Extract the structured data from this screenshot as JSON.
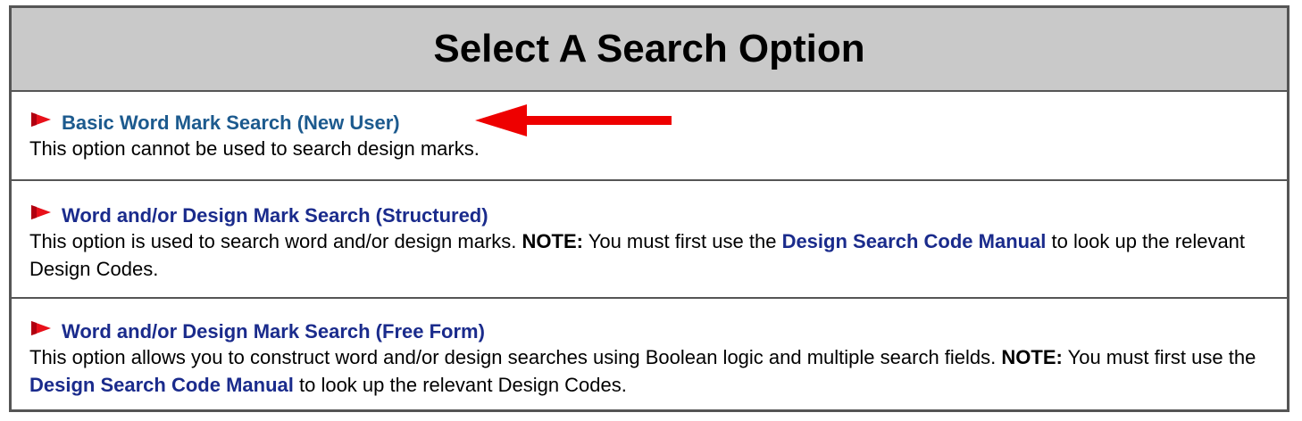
{
  "header": {
    "title": "Select A Search Option"
  },
  "options": [
    {
      "icon": "red-bullet-icon",
      "title": "Basic Word Mark Search (New User)",
      "description": "This option cannot be used to search design marks."
    },
    {
      "icon": "red-bullet-icon",
      "title": "Word and/or Design Mark Search (Structured)",
      "description_before": "This option is used to search word and/or design marks.",
      "note_label": "NOTE:",
      "description_mid": "You must first use the",
      "manual_link": "Design Search Code Manual",
      "description_after": "to look up the relevant Design Codes."
    },
    {
      "icon": "red-bullet-icon",
      "title": "Word and/or Design Mark Search (Free Form)",
      "description_before": "This option allows you to construct word and/or design searches using Boolean logic and multiple search fields.",
      "note_label": "NOTE:",
      "description_mid": "You must first use the",
      "manual_link": "Design Search Code Manual",
      "description_after": "to look up the relevant Design Codes."
    }
  ],
  "annotation": {
    "icon": "red-arrow-icon",
    "color": "#ee0000"
  },
  "colors": {
    "header_bg": "#c9c9c9",
    "border": "#555555",
    "link": "#1a2b8c",
    "bullet": "#e8101a"
  }
}
